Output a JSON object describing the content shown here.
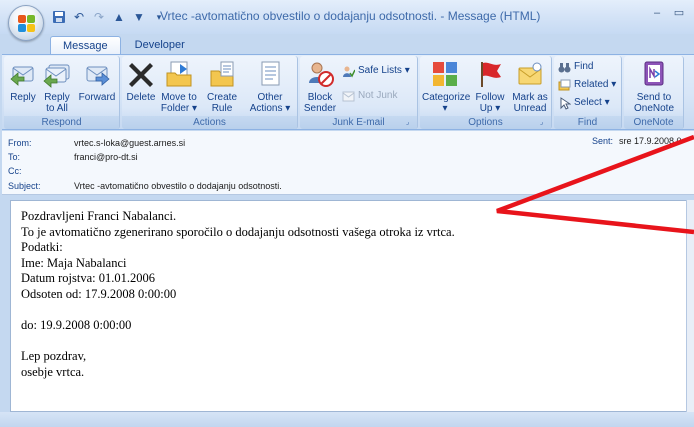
{
  "window": {
    "title": "Vrtec -avtomatično obvestilo o dodajanju odsotnosti. - Message (HTML)"
  },
  "tabs": [
    {
      "label": "Message",
      "active": true
    },
    {
      "label": "Developer",
      "active": false
    }
  ],
  "ribbon": {
    "respond": {
      "label": "Respond",
      "reply": "Reply",
      "reply_all": "Reply\nto All",
      "forward": "Forward"
    },
    "actions": {
      "label": "Actions",
      "delete": "Delete",
      "move_to_folder": "Move to\nFolder ▾",
      "create_rule": "Create\nRule",
      "other_actions": "Other\nActions ▾"
    },
    "junk": {
      "label": "Junk E-mail",
      "block_sender": "Block\nSender",
      "safe_lists": "Safe Lists ▾",
      "not_junk": "Not Junk"
    },
    "options": {
      "label": "Options",
      "categorize": "Categorize\n▾",
      "follow_up": "Follow\nUp ▾",
      "mark_as_unread": "Mark as\nUnread"
    },
    "find": {
      "label": "Find",
      "find": "Find",
      "related": "Related ▾",
      "select": "Select ▾"
    },
    "onenote": {
      "label": "OneNote",
      "send_to_onenote": "Send to\nOneNote"
    }
  },
  "header": {
    "from_label": "From:",
    "from_value": "vrtec.s-loka@guest.arnes.si",
    "to_label": "To:",
    "to_value": "franci@pro-dt.si",
    "cc_label": "Cc:",
    "cc_value": "",
    "subject_label": "Subject:",
    "subject_value": "Vrtec -avtomatično obvestilo o dodajanju odsotnosti.",
    "sent_label": "Sent:",
    "sent_value": "sre 17.9.2008 0"
  },
  "body": {
    "text": "Pozdravljeni Franci Nabalanci.\nTo je avtomatično zgenerirano sporočilo o dodajanju odsotnosti vašega otroka iz vrtca.\nPodatki:\nIme: Maja Nabalanci\nDatum rojstva: 01.01.2006\nOdsoten od: 17.9.2008 0:00:00\n\ndo: 19.9.2008 0:00:00\n\nLep pozdrav,\nosebje vrtca."
  },
  "colors": {
    "annotation": "#e8141b",
    "ribbon_text": "#15428b"
  }
}
